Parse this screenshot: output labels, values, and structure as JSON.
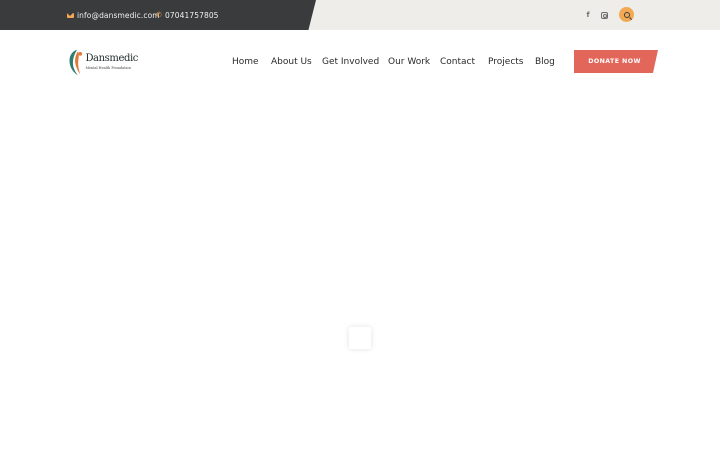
{
  "topbar": {
    "email": "info@dansmedic.com",
    "phone": "07041757805",
    "icons": [
      "envelope-icon",
      "phone-icon",
      "facebook-icon",
      "instagram-icon",
      "search-icon"
    ]
  },
  "logo": {
    "name": "Dansmedic",
    "tagline": "Mental Health Foundation"
  },
  "nav": {
    "items": [
      "Home",
      "About Us",
      "Get Involved",
      "Our Work",
      "Contact",
      "Projects",
      "Blog"
    ]
  },
  "cta": {
    "donate_label": "DONATE NOW"
  },
  "colors": {
    "topbar_dark": "#3a3b3d",
    "topbar_light": "#eeedea",
    "accent_orange": "#f3a953",
    "donate_red": "#e2665a"
  }
}
